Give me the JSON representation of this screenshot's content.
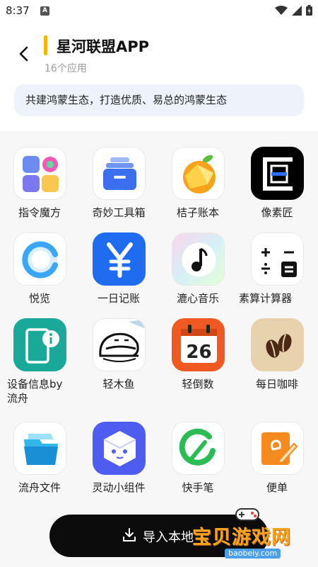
{
  "status_bar": {
    "time": "8:37",
    "notification_letter": "A"
  },
  "header": {
    "title": "星河联盟APP",
    "subtitle": "16个应用",
    "accent_color": "#f5b400"
  },
  "slogan": "共建鸿蒙生态，打造优质、易总的鸿蒙生态",
  "apps": [
    {
      "label": "指令魔方",
      "icon": "command-cube-icon"
    },
    {
      "label": "奇妙工具箱",
      "icon": "toolbox-icon"
    },
    {
      "label": "桔子账本",
      "icon": "orange-ledger-icon"
    },
    {
      "label": "像素匠",
      "icon": "pixel-icon"
    },
    {
      "label": "悦览",
      "icon": "browser-ring-icon"
    },
    {
      "label": "一日记账",
      "icon": "yen-icon"
    },
    {
      "label": "漉心音乐",
      "icon": "music-note-icon"
    },
    {
      "label": "素算计算器",
      "icon": "calculator-icon"
    },
    {
      "label": "设备信息by流舟",
      "icon": "device-info-icon"
    },
    {
      "label": "轻木鱼",
      "icon": "wooden-fish-icon"
    },
    {
      "label": "轻倒数",
      "icon": "calendar-countdown-icon",
      "icon_text": "26"
    },
    {
      "label": "每日咖啡",
      "icon": "coffee-bean-icon"
    },
    {
      "label": "流舟文件",
      "icon": "folder-icon"
    },
    {
      "label": "灵动小组件",
      "icon": "widget-robot-icon"
    },
    {
      "label": "快手笔",
      "icon": "pen-icon"
    },
    {
      "label": "便单",
      "icon": "memo-icon"
    }
  ],
  "import_button": {
    "label": "导入本地"
  },
  "watermark": {
    "text": "宝贝游戏网",
    "url": "baobeiy.com"
  }
}
